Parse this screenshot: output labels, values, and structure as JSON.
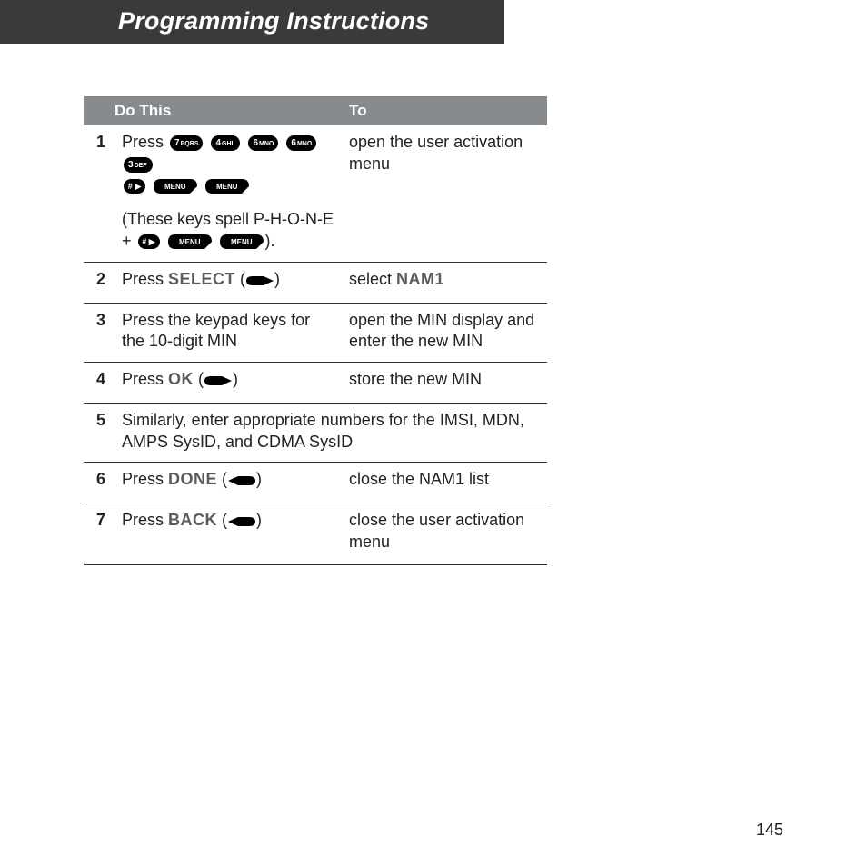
{
  "chapter_title": "Programming Instructions",
  "page_number": "145",
  "keys": {
    "k7": {
      "num": "7",
      "letters": "PQRS"
    },
    "k4": {
      "num": "4",
      "letters": "GHI"
    },
    "k6": {
      "num": "6",
      "letters": "MNO"
    },
    "k3": {
      "num": "3",
      "letters": "DEF"
    },
    "hash": "# ▶",
    "menu": "MENU"
  },
  "labels": {
    "select": "SELECT",
    "ok": "OK",
    "done": "DONE",
    "back": "BACK",
    "nam1": "NAM1"
  },
  "table": {
    "header_dothis": "Do This",
    "header_to": "To",
    "rows": [
      {
        "n": "1",
        "do_pre": "Press ",
        "do_note_pre": "(These keys spell P-H-O-N-E + ",
        "do_note_post": ").",
        "to": "open the user activation menu"
      },
      {
        "n": "2",
        "do_pre": "Press ",
        "to_pre": "select "
      },
      {
        "n": "3",
        "do": "Press the keypad keys for the 10-digit MIN",
        "to": "open the MIN display and enter the new MIN"
      },
      {
        "n": "4",
        "do_pre": "Press ",
        "to": "store the new MIN"
      },
      {
        "n": "5",
        "do": "Similarly, enter appropriate numbers for the IMSI, MDN, AMPS SysID, and CDMA SysID"
      },
      {
        "n": "6",
        "do_pre": "Press ",
        "to": "close the NAM1 list"
      },
      {
        "n": "7",
        "do_pre": "Press ",
        "to": "close the user activation menu"
      }
    ]
  }
}
